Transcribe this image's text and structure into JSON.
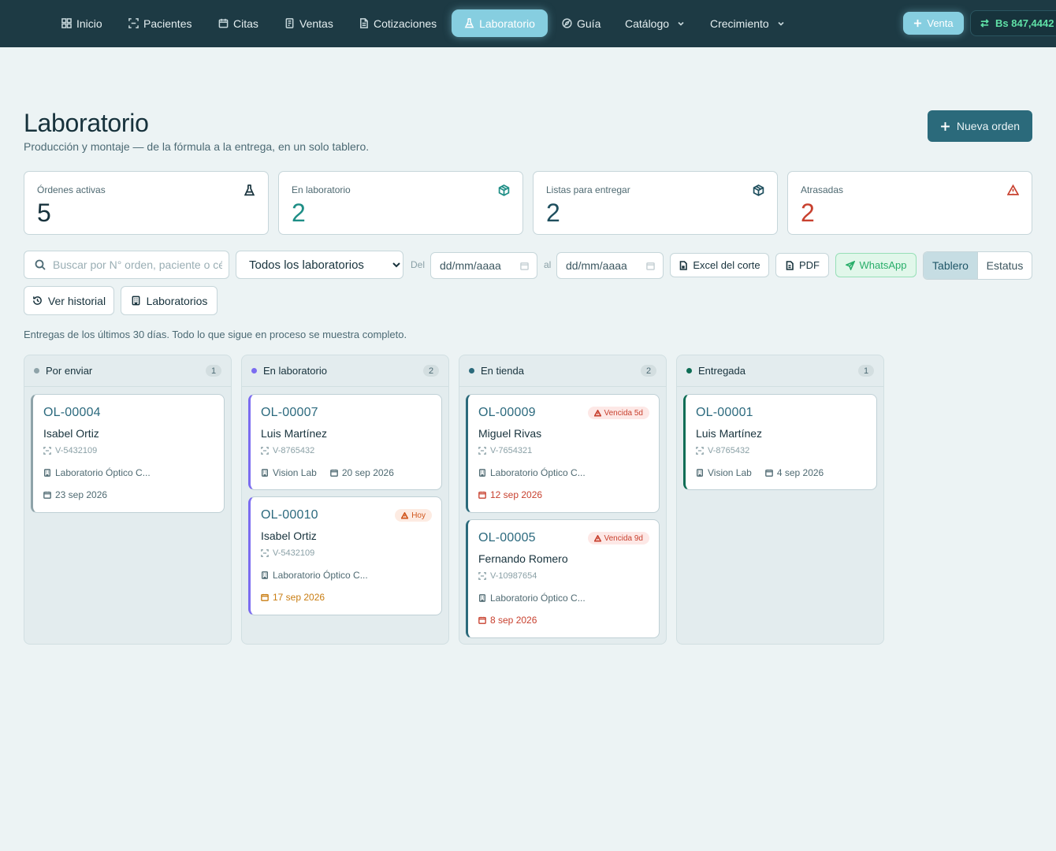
{
  "nav": {
    "items": [
      {
        "label": "Inicio",
        "icon": "grid-icon"
      },
      {
        "label": "Pacientes",
        "icon": "scan-icon"
      },
      {
        "label": "Citas",
        "icon": "calendar-icon"
      },
      {
        "label": "Ventas",
        "icon": "receipt-icon"
      },
      {
        "label": "Cotizaciones",
        "icon": "document-icon"
      },
      {
        "label": "Laboratorio",
        "icon": "flask-icon",
        "active": true
      },
      {
        "label": "Guía",
        "icon": "compass-icon"
      },
      {
        "label": "Catálogo",
        "icon": "chevron-down-icon"
      },
      {
        "label": "Crecimiento",
        "icon": "chevron-down-icon"
      }
    ],
    "venta_label": "Venta",
    "rate": "Bs 847,4442"
  },
  "header": {
    "title": "Laboratorio",
    "subtitle": "Producción y montaje — de la fórmula a la entrega, en un solo tablero.",
    "new_order_label": "Nueva orden"
  },
  "stats": [
    {
      "label": "Órdenes activas",
      "value": "5",
      "icon": "flask-icon",
      "color": "#17323c"
    },
    {
      "label": "En laboratorio",
      "value": "2",
      "icon": "box-icon",
      "color": "#1e8e86"
    },
    {
      "label": "Listas para entregar",
      "value": "2",
      "icon": "box-icon",
      "color": "#1f4f5e"
    },
    {
      "label": "Atrasadas",
      "value": "2",
      "icon": "warning-icon",
      "color": "#c8412f"
    }
  ],
  "filters": {
    "search_placeholder": "Buscar por N° orden, paciente o cédula",
    "lab_select_value": "Todos los laboratorios",
    "from_label": "Del",
    "to_label": "al",
    "date_placeholder": "dd/mm/aaaa",
    "excel_label": "Excel del corte",
    "pdf_label": "PDF",
    "whatsapp_label": "WhatsApp",
    "view_board": "Tablero",
    "view_status": "Estatus",
    "history_label": "Ver historial",
    "labs_label": "Laboratorios"
  },
  "notice": "Entregas de los últimos 30 días. Todo lo que sigue en proceso se muestra completo.",
  "columns": [
    {
      "title": "Por enviar",
      "count": "1",
      "color": "#8ea3a9",
      "cards": [
        {
          "id": "OL-00004",
          "name": "Isabel Ortiz",
          "doc": "V-5432109",
          "lab": "Laboratorio Óptico C...",
          "date": "23 sep 2026",
          "date_state": "normal"
        }
      ]
    },
    {
      "title": "En laboratorio",
      "count": "2",
      "color": "#7b6cf0",
      "cards": [
        {
          "id": "OL-00007",
          "name": "Luis Martínez",
          "doc": "V-8765432",
          "lab": "Vision Lab",
          "date": "20 sep 2026",
          "date_state": "normal"
        },
        {
          "id": "OL-00010",
          "name": "Isabel Ortiz",
          "doc": "V-5432109",
          "lab": "Laboratorio Óptico C...",
          "date": "17 sep 2026",
          "date_state": "amber",
          "badge": "Hoy",
          "badge_type": "warn"
        }
      ]
    },
    {
      "title": "En tienda",
      "count": "2",
      "color": "#2b6a7b",
      "cards": [
        {
          "id": "OL-00009",
          "name": "Miguel Rivas",
          "doc": "V-7654321",
          "lab": "Laboratorio Óptico C...",
          "date": "12 sep 2026",
          "date_state": "red",
          "badge": "Vencida 5d",
          "badge_type": "danger"
        },
        {
          "id": "OL-00005",
          "name": "Fernando Romero",
          "doc": "V-10987654",
          "lab": "Laboratorio Óptico C...",
          "date": "8 sep 2026",
          "date_state": "red",
          "badge": "Vencida 9d",
          "badge_type": "danger"
        }
      ]
    },
    {
      "title": "Entregada",
      "count": "1",
      "color": "#0e6d55",
      "cards": [
        {
          "id": "OL-00001",
          "name": "Luis Martínez",
          "doc": "V-8765432",
          "lab": "Vision Lab",
          "date": "4 sep 2026",
          "date_state": "normal"
        }
      ]
    }
  ]
}
